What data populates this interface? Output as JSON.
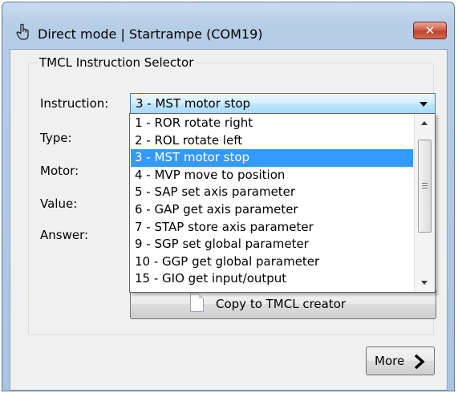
{
  "window": {
    "title": "Direct mode | Startrampe (COM19)",
    "close_label": "✕"
  },
  "group": {
    "title": "TMCL Instruction Selector"
  },
  "labels": {
    "instruction": "Instruction:",
    "type": "Type:",
    "motor": "Motor:",
    "value": "Value:",
    "answer": "Answer:"
  },
  "instruction_select": {
    "selected": "3 - MST motor stop",
    "options": [
      "1 - ROR rotate right",
      "2 - ROL rotate left",
      "3 - MST motor stop",
      "4 - MVP move to position",
      "5 - SAP set axis parameter",
      "6 - GAP get axis parameter",
      "7 - STAP store axis parameter",
      "9 - SGP set global parameter",
      "10 - GGP get global parameter",
      "15 - GIO get input/output"
    ],
    "selected_index": 2
  },
  "buttons": {
    "copy": "Copy to TMCL creator",
    "more": "More"
  },
  "icons": {
    "window": "hand-pointer-icon",
    "copy": "document-icon",
    "more": "chevron-right-icon"
  }
}
